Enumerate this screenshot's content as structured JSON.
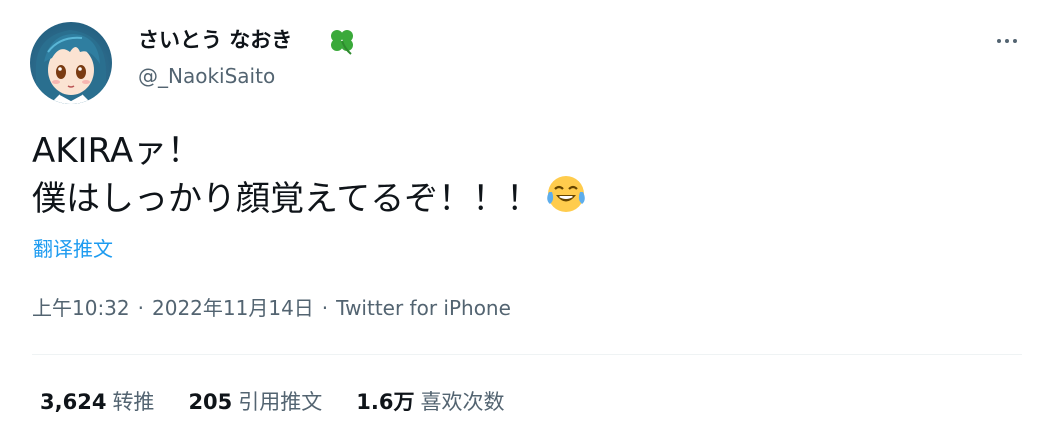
{
  "author": {
    "display_name": "さいとう なおき",
    "name_emoji": "four-leaf-clover-icon",
    "handle": "@_NaokiSaito",
    "avatar": "anime-avatar-teal-hair"
  },
  "tweet": {
    "line1": "AKIRAァ！",
    "line2": "僕はしっかり顔覚えてるぞ！！！",
    "trailing_emoji": "face-with-tears-of-joy-icon"
  },
  "translate_label": "翻译推文",
  "meta": {
    "time": "上午10:32",
    "separator": "·",
    "date": "2022年11月14日",
    "source": "Twitter for iPhone"
  },
  "stats": {
    "retweets_count": "3,624",
    "retweets_label": "转推",
    "quotes_count": "205",
    "quotes_label": "引用推文",
    "likes_count": "1.6万",
    "likes_label": "喜欢次数"
  },
  "colors": {
    "text": "#0f1419",
    "secondary": "#536471",
    "link": "#1d9bf0",
    "divider": "#eff3f4",
    "clover": "#3aa93a"
  }
}
